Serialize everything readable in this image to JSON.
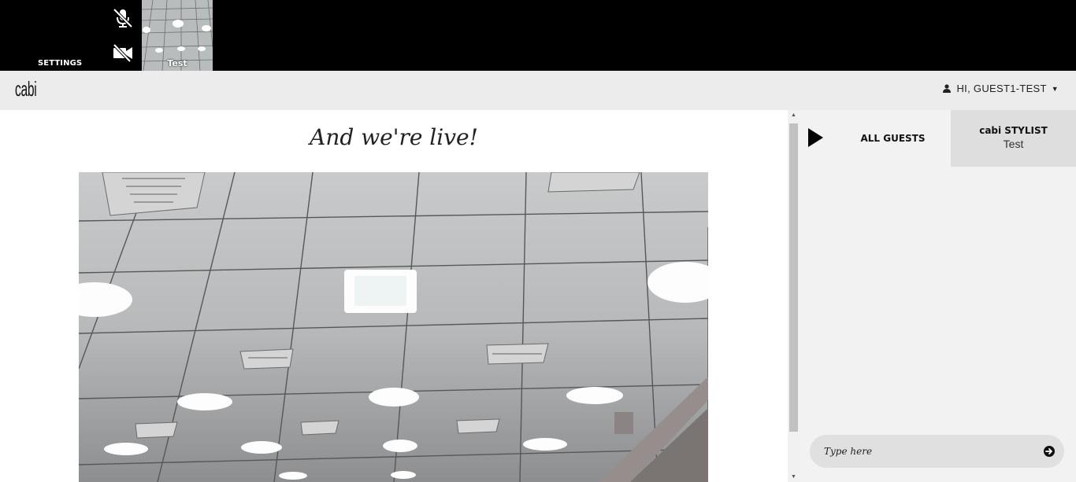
{
  "topbar": {
    "settings_label": "SETTINGS",
    "mic_icon": "mic-muted-icon",
    "camera_icon": "camera-off-icon",
    "self_view_label": "Test"
  },
  "header": {
    "logo_text": "cabi",
    "user_greeting": "HI, GUEST1-TEST",
    "user_icon": "user-icon"
  },
  "main": {
    "title": "And we're live!"
  },
  "chat": {
    "tabs": [
      {
        "label": "ALL GUESTS"
      },
      {
        "title": "cabi STYLIST",
        "subtitle": "Test"
      }
    ],
    "input_placeholder": "Type here",
    "send_icon": "arrow-circle-right-icon"
  },
  "colors": {
    "topbar_bg": "#000000",
    "header_bg": "#ececec",
    "chat_bg": "#f2f2f2",
    "active_tab_bg": "#dedede"
  }
}
